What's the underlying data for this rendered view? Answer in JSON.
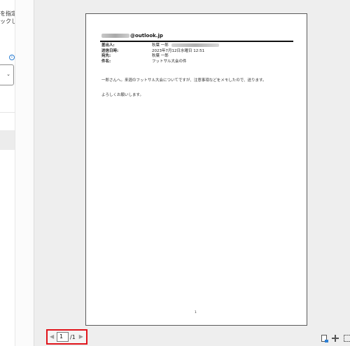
{
  "left_panel": {
    "text_lines": [
      "を指定し",
      "ックしま"
    ],
    "info_icon": "info-icon",
    "select_chevron": "chevron-down-icon"
  },
  "email": {
    "sender_domain": "@outlook.jp",
    "fields": [
      {
        "label": "差出人:",
        "value": "秋葉 一郎"
      },
      {
        "label": "送信日時:",
        "value": "2023年7月12日水曜日 12:51"
      },
      {
        "label": "宛先:",
        "value": "秋葉 一郎"
      },
      {
        "label": "件名:",
        "value": "フットサル大会の件"
      }
    ],
    "body_lines": [
      "一郎さんへ。来週のフットサル大会についてですが、注意事項などをメモしたので、送ります。",
      "よろしくお願いします。"
    ],
    "page_number": "1"
  },
  "pager": {
    "current_page": "1",
    "total": "/1",
    "prev_icon": "triangle-left-icon",
    "next_icon": "triangle-right-icon"
  },
  "tools": [
    "page-view-icon",
    "move-icon",
    "grid-icon"
  ],
  "colors": {
    "highlight": "#e0141b",
    "accent": "#2d7fd3",
    "preview_bg": "#eeeeee"
  }
}
